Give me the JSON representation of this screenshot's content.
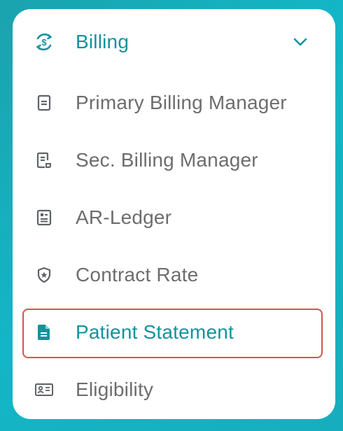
{
  "menu": {
    "header": {
      "label": "Billing",
      "icon": "dollar-cycle-icon",
      "expanded": true,
      "toggle_icon": "chevron-down-icon"
    },
    "items": [
      {
        "label": "Primary Billing Manager",
        "icon": "document-icon",
        "active": false
      },
      {
        "label": "Sec. Billing Manager",
        "icon": "document-edit-icon",
        "active": false
      },
      {
        "label": "AR-Ledger",
        "icon": "ledger-icon",
        "active": false
      },
      {
        "label": "Contract Rate",
        "icon": "shield-star-icon",
        "active": false
      },
      {
        "label": "Patient Statement",
        "icon": "file-filled-icon",
        "active": true
      },
      {
        "label": "Eligibility",
        "icon": "id-card-icon",
        "active": false
      }
    ]
  },
  "colors": {
    "accent": "#14929d",
    "text": "#6d6d6d",
    "icon": "#5f6368",
    "active_outline": "#d9534f",
    "background": "#13b6c6"
  }
}
